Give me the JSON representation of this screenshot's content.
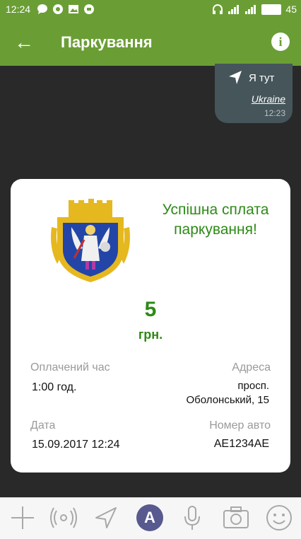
{
  "status": {
    "time": "12:24",
    "battery": "45"
  },
  "app_bar": {
    "title": "Паркування"
  },
  "message": {
    "here": "Я тут",
    "country": "Ukraine",
    "time": "12:23"
  },
  "receipt": {
    "success": "Успішна сплата паркування!",
    "amount": "5",
    "currency": "грн.",
    "paid_time_label": "Оплачений час",
    "paid_time_value": "1:00 год.",
    "address_label": "Адреса",
    "address_line1": "просп.",
    "address_line2": "Оболонський, 15",
    "date_label": "Дата",
    "date_value": "15.09.2017 12:24",
    "car_label": "Номер авто",
    "car_value": "AE1234AE"
  },
  "bottom_bar": {
    "icons": [
      "plus-icon",
      "broadcast-icon",
      "send-location-icon",
      "a-icon",
      "microphone-icon",
      "camera-icon",
      "emoji-icon"
    ]
  }
}
